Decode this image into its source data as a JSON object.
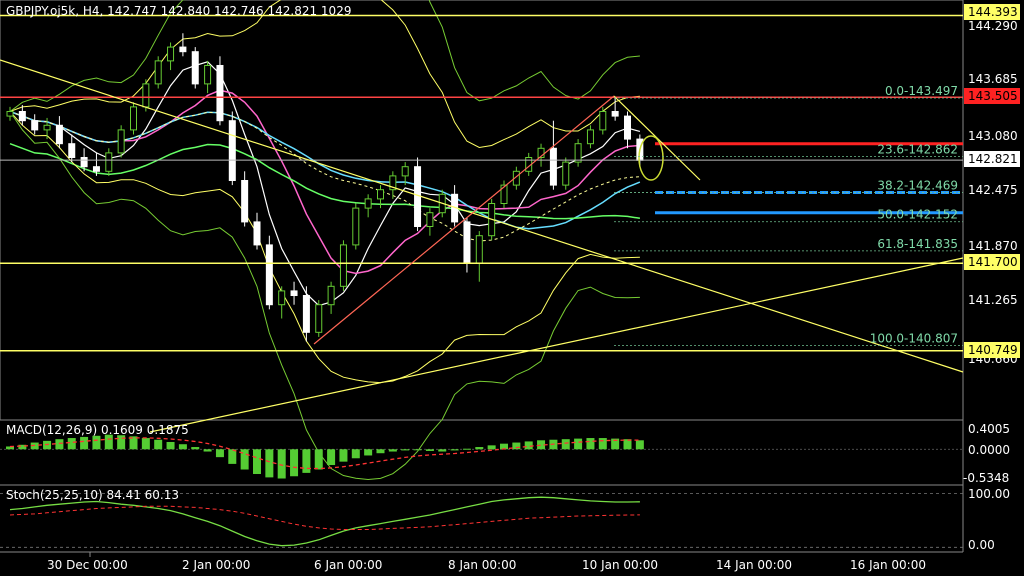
{
  "header": {
    "symbol_line": "GBPJPY.oj5k, H4, 142.747 142.840 142.746 142.821 1029"
  },
  "price_axis": {
    "ticks": [
      "144.290",
      "143.685",
      "143.080",
      "142.475",
      "141.870",
      "141.265",
      "140.660"
    ]
  },
  "tags": {
    "top_line": "144.393",
    "red_line": "143.505",
    "current": "142.821",
    "support": "141.700",
    "low_line": "140.749"
  },
  "tag_colors": {
    "yellow": "#ffff66",
    "red": "#ff2222",
    "white": "#ffffff"
  },
  "fibo": [
    {
      "label": "0.0-143.497",
      "price": 143.497
    },
    {
      "label": "23.6-142.862",
      "price": 142.862
    },
    {
      "label": "38.2-142.469",
      "price": 142.469
    },
    {
      "label": "50.0-142.152",
      "price": 142.152
    },
    {
      "label": "61.8-141.835",
      "price": 141.835
    },
    {
      "label": "100.0-140.807",
      "price": 140.807
    }
  ],
  "macd": {
    "title": "MACD(12,26,9) 0.1609 0.1875",
    "ticks": [
      "0.4005",
      "0.0000",
      "-0.5348"
    ]
  },
  "stoch": {
    "title": "Stoch(25,25,10) 84.41 60.13",
    "ticks": [
      "100.00",
      "0.00"
    ]
  },
  "time_axis": {
    "labels": [
      "30 Dec 00:00",
      "2 Jan 00:00",
      "6 Jan 00:00",
      "8 Jan 00:00",
      "10 Jan 00:00",
      "14 Jan 00:00",
      "16 Jan 00:00"
    ]
  },
  "chart_data": {
    "type": "line",
    "title": "GBPJPY.oj5k, H4",
    "price_range": [
      140.55,
      144.45
    ],
    "macd_range": [
      -0.6,
      0.45
    ],
    "stoch_range": [
      -5,
      110
    ],
    "candles": [
      [
        143.3,
        143.4,
        143.25,
        143.35
      ],
      [
        143.35,
        143.42,
        143.2,
        143.25
      ],
      [
        143.25,
        143.32,
        143.1,
        143.15
      ],
      [
        143.15,
        143.28,
        143.05,
        143.2
      ],
      [
        143.2,
        143.3,
        142.95,
        143.0
      ],
      [
        143.0,
        143.1,
        142.8,
        142.85
      ],
      [
        142.85,
        142.95,
        142.7,
        142.75
      ],
      [
        142.75,
        142.9,
        142.65,
        142.7
      ],
      [
        142.7,
        142.95,
        142.65,
        142.9
      ],
      [
        142.9,
        143.2,
        142.85,
        143.15
      ],
      [
        143.15,
        143.45,
        143.1,
        143.4
      ],
      [
        143.4,
        143.7,
        143.35,
        143.65
      ],
      [
        143.65,
        143.95,
        143.6,
        143.9
      ],
      [
        143.9,
        144.1,
        143.8,
        144.05
      ],
      [
        144.05,
        144.2,
        143.95,
        144.0
      ],
      [
        144.0,
        144.05,
        143.6,
        143.65
      ],
      [
        143.65,
        143.9,
        143.55,
        143.85
      ],
      [
        143.85,
        143.95,
        143.2,
        143.25
      ],
      [
        143.25,
        143.35,
        142.55,
        142.6
      ],
      [
        142.6,
        142.7,
        142.1,
        142.15
      ],
      [
        142.15,
        142.25,
        141.85,
        141.9
      ],
      [
        141.9,
        142.0,
        141.2,
        141.25
      ],
      [
        141.25,
        141.45,
        141.1,
        141.4
      ],
      [
        141.4,
        141.5,
        141.25,
        141.35
      ],
      [
        141.35,
        141.45,
        140.85,
        140.95
      ],
      [
        140.95,
        141.3,
        140.9,
        141.25
      ],
      [
        141.25,
        141.5,
        141.15,
        141.45
      ],
      [
        141.45,
        141.95,
        141.4,
        141.9
      ],
      [
        141.9,
        142.35,
        141.85,
        142.3
      ],
      [
        142.3,
        142.45,
        142.2,
        142.4
      ],
      [
        142.4,
        142.55,
        142.3,
        142.5
      ],
      [
        142.5,
        142.7,
        142.4,
        142.65
      ],
      [
        142.65,
        142.8,
        142.55,
        142.75
      ],
      [
        142.75,
        142.85,
        142.05,
        142.1
      ],
      [
        142.1,
        142.3,
        142.0,
        142.25
      ],
      [
        142.25,
        142.5,
        142.2,
        142.45
      ],
      [
        142.45,
        142.55,
        142.1,
        142.15
      ],
      [
        142.15,
        142.2,
        141.6,
        141.7
      ],
      [
        141.7,
        142.05,
        141.5,
        142.0
      ],
      [
        142.0,
        142.4,
        141.95,
        142.35
      ],
      [
        142.35,
        142.6,
        142.3,
        142.55
      ],
      [
        142.55,
        142.75,
        142.5,
        142.7
      ],
      [
        142.7,
        142.9,
        142.65,
        142.85
      ],
      [
        142.85,
        143.0,
        142.75,
        142.95
      ],
      [
        142.95,
        143.25,
        142.5,
        142.55
      ],
      [
        142.55,
        142.85,
        142.5,
        142.8
      ],
      [
        142.8,
        143.05,
        142.75,
        143.0
      ],
      [
        143.0,
        143.2,
        142.95,
        143.15
      ],
      [
        143.15,
        143.4,
        143.1,
        143.35
      ],
      [
        143.35,
        143.5,
        143.25,
        143.3
      ],
      [
        143.3,
        143.35,
        142.95,
        143.05
      ],
      [
        143.05,
        143.1,
        142.75,
        142.82
      ]
    ],
    "macd_hist": [
      0.05,
      0.08,
      0.12,
      0.15,
      0.18,
      0.2,
      0.22,
      0.24,
      0.26,
      0.25,
      0.23,
      0.2,
      0.17,
      0.13,
      0.09,
      0.04,
      -0.04,
      -0.14,
      -0.26,
      -0.36,
      -0.44,
      -0.5,
      -0.52,
      -0.48,
      -0.42,
      -0.36,
      -0.28,
      -0.22,
      -0.16,
      -0.11,
      -0.07,
      -0.04,
      -0.02,
      -0.01,
      -0.03,
      -0.04,
      -0.02,
      0.01,
      0.04,
      0.07,
      0.1,
      0.12,
      0.14,
      0.16,
      0.17,
      0.18,
      0.19,
      0.2,
      0.2,
      0.19,
      0.18,
      0.16
    ],
    "stoch_main": [
      70,
      72,
      75,
      78,
      80,
      82,
      84,
      85,
      83,
      80,
      78,
      75,
      72,
      68,
      62,
      55,
      48,
      40,
      30,
      20,
      12,
      6,
      3,
      4,
      8,
      14,
      22,
      30,
      36,
      40,
      44,
      48,
      52,
      56,
      60,
      65,
      70,
      75,
      80,
      85,
      88,
      90,
      92,
      93,
      92,
      90,
      88,
      86,
      85,
      84,
      84,
      84.41
    ],
    "stoch_signal": [
      60,
      61,
      62,
      64,
      66,
      68,
      70,
      72,
      73,
      74,
      75,
      76,
      76,
      76,
      75,
      74,
      72,
      70,
      67,
      63,
      58,
      53,
      48,
      43,
      39,
      36,
      34,
      33,
      33,
      33,
      34,
      35,
      36,
      37,
      38,
      40,
      42,
      44,
      46,
      48,
      50,
      52,
      54,
      55,
      56,
      57,
      58,
      58.5,
      59,
      59.5,
      60,
      60.13
    ]
  }
}
